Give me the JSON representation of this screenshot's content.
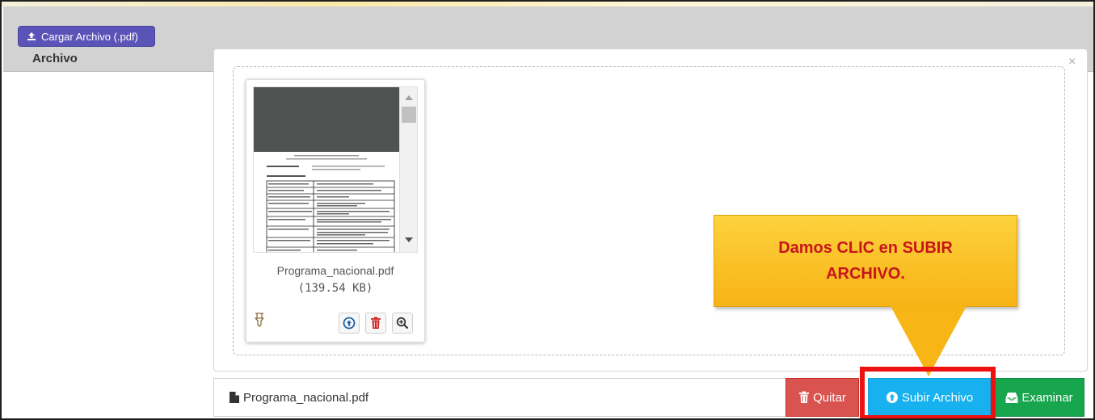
{
  "header": {
    "upload_button_label": "Cargar Archivo (.pdf)",
    "section_label": "Archivo"
  },
  "dialog": {
    "close_symbol": "×"
  },
  "file": {
    "name": "Programa_nacional.pdf",
    "size": "(139.54 KB)"
  },
  "actions": {
    "upload_icon": "circle-arrow-up-icon",
    "remove_icon": "trash-icon",
    "zoom_icon": "zoom-in-icon",
    "drag_icon": "drag-handle-icon"
  },
  "footer": {
    "caption": "Programa_nacional.pdf",
    "remove_label": "Quitar",
    "upload_label": "Subir Archivo",
    "browse_label": "Examinar"
  },
  "callout": {
    "text": "Damos CLIC en SUBIR ARCHIVO."
  },
  "colors": {
    "upload_btn": "#5b54b8",
    "remove_btn": "#d9534f",
    "submit_btn": "#17b1ef",
    "browse_btn": "#17a54d",
    "callout": "#f8b616",
    "callout_text": "#c8151a",
    "highlight": "#ee1111"
  }
}
